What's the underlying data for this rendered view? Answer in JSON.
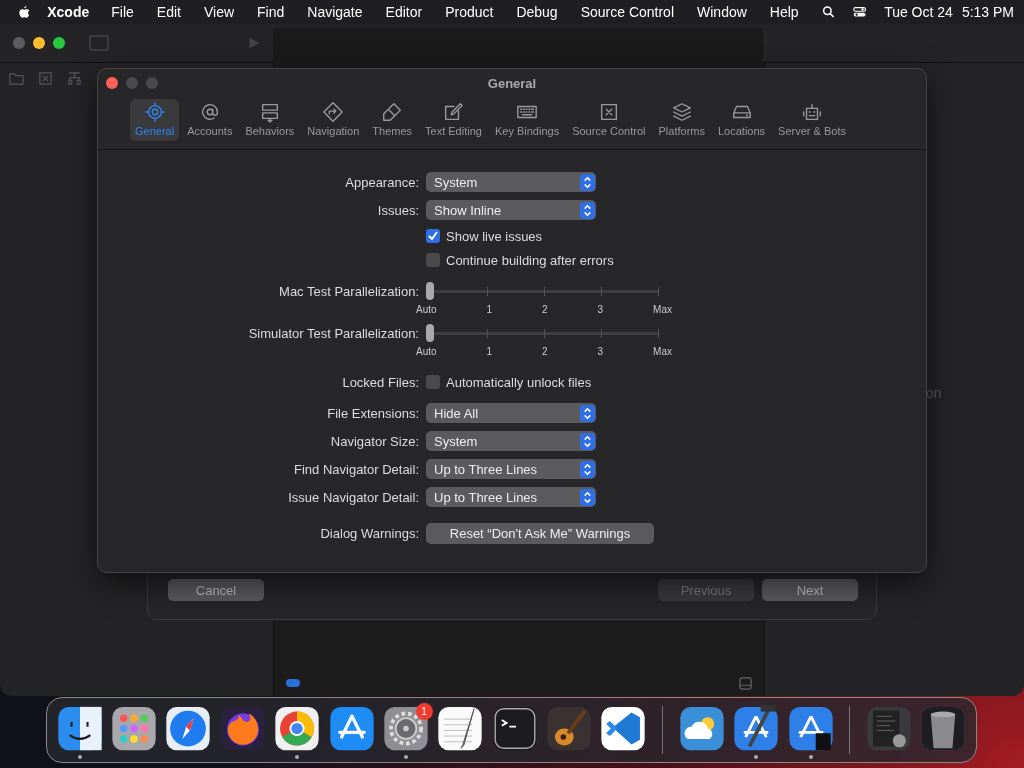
{
  "menu_bar": {
    "app": "Xcode",
    "items": [
      "File",
      "Edit",
      "View",
      "Find",
      "Navigate",
      "Editor",
      "Product",
      "Debug",
      "Source Control",
      "Window",
      "Help"
    ],
    "date": "Tue Oct 24",
    "time": "5:13 PM"
  },
  "background_text": "on",
  "sheet": {
    "buttons": [
      {
        "label": "Cancel",
        "disabled": false
      },
      {
        "label": "Previous",
        "disabled": true
      },
      {
        "label": "Next",
        "disabled": false
      }
    ]
  },
  "preferences": {
    "title": "General",
    "tabs": [
      {
        "label": "General",
        "selected": true
      },
      {
        "label": "Accounts",
        "selected": false
      },
      {
        "label": "Behaviors",
        "selected": false
      },
      {
        "label": "Navigation",
        "selected": false
      },
      {
        "label": "Themes",
        "selected": false
      },
      {
        "label": "Text Editing",
        "selected": false
      },
      {
        "label": "Key Bindings",
        "selected": false
      },
      {
        "label": "Source Control",
        "selected": false
      },
      {
        "label": "Platforms",
        "selected": false
      },
      {
        "label": "Locations",
        "selected": false
      },
      {
        "label": "Server & Bots",
        "selected": false
      }
    ],
    "rows": [
      {
        "kind": "popup",
        "label": "Appearance:",
        "value": "System"
      },
      {
        "kind": "popup",
        "label": "Issues:",
        "value": "Show Inline"
      },
      {
        "kind": "checkbox",
        "text": "Show live issues",
        "checked": true
      },
      {
        "kind": "checkbox",
        "text": "Continue building after errors",
        "checked": false
      },
      {
        "kind": "slider",
        "label": "Mac Test Parallelization:",
        "level": 0,
        "ticks": [
          "Auto",
          "1",
          "2",
          "3",
          "Max"
        ]
      },
      {
        "kind": "slider",
        "label": "Simulator Test Parallelization:",
        "level": 0,
        "ticks": [
          "Auto",
          "1",
          "2",
          "3",
          "Max"
        ]
      },
      {
        "kind": "checkbox",
        "label": "Locked Files:",
        "text": "Automatically unlock files",
        "checked": false
      },
      {
        "kind": "popup",
        "label": "File Extensions:",
        "value": "Hide All"
      },
      {
        "kind": "popup",
        "label": "Navigator Size:",
        "value": "System"
      },
      {
        "kind": "popup",
        "label": "Find Navigator Detail:",
        "value": "Up to Three Lines"
      },
      {
        "kind": "popup",
        "label": "Issue Navigator Detail:",
        "value": "Up to Three Lines"
      },
      {
        "kind": "button",
        "label": "Dialog Warnings:",
        "text": "Reset “Don't Ask Me” Warnings"
      }
    ]
  },
  "dock": {
    "items": [
      {
        "kind": "app",
        "running": true
      },
      {
        "kind": "app",
        "running": false
      },
      {
        "kind": "app",
        "running": false
      },
      {
        "kind": "app",
        "running": false
      },
      {
        "kind": "app",
        "running": true
      },
      {
        "kind": "app",
        "running": false
      },
      {
        "kind": "app",
        "running": true,
        "badge": "1"
      },
      {
        "kind": "app",
        "running": false
      },
      {
        "kind": "app",
        "running": false
      },
      {
        "kind": "app",
        "running": false
      },
      {
        "kind": "app",
        "running": false
      },
      {
        "kind": "separator"
      },
      {
        "kind": "app",
        "running": false
      },
      {
        "kind": "app",
        "running": true
      },
      {
        "kind": "app",
        "running": true
      },
      {
        "kind": "separator"
      },
      {
        "kind": "app",
        "running": false
      },
      {
        "kind": "app",
        "running": false
      }
    ]
  }
}
